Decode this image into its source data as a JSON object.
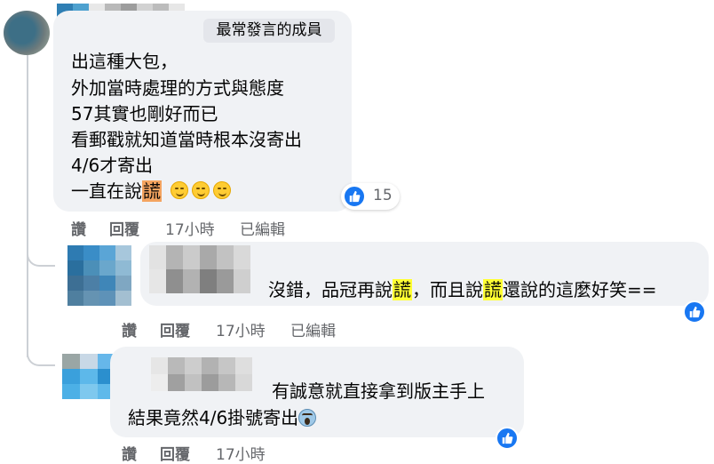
{
  "comment1": {
    "badge": "最常發言的成員",
    "lines": [
      "出這種大包，",
      "外加當時處理的方式與態度",
      "57其實也剛好而已",
      "看郵戳就知道當時根本沒寄出",
      "4/6才寄出"
    ],
    "last_line_pre": "一直在說",
    "last_line_highlight": "謊",
    "reaction_count": "15",
    "actions": {
      "like": "讚",
      "reply": "回覆",
      "time": "17小時",
      "edited": "已編輯"
    }
  },
  "comment2": {
    "text_pre": "沒錯，品冠再說",
    "hl1": "謊",
    "text_mid": "，而且說",
    "hl2": "謊",
    "text_post": "還說的這麼好笑==",
    "actions": {
      "like": "讚",
      "reply": "回覆",
      "time": "17小時",
      "edited": "已編輯"
    }
  },
  "comment3": {
    "line1": "有誠意就直接拿到版主手上",
    "line2": "結果竟然4/6掛號寄出",
    "actions": {
      "like": "讚",
      "reply": "回覆",
      "time": "17小時"
    }
  },
  "colors": {
    "bubble": "#f0f2f5",
    "like_blue": "#1877f2",
    "meta_gray": "#65676b",
    "highlight_yellow": "#ffff33",
    "highlight_orange": "#f4a460"
  },
  "icons": [
    "like-icon",
    "smirk-emoji-icon",
    "screaming-face-emoji-icon"
  ]
}
